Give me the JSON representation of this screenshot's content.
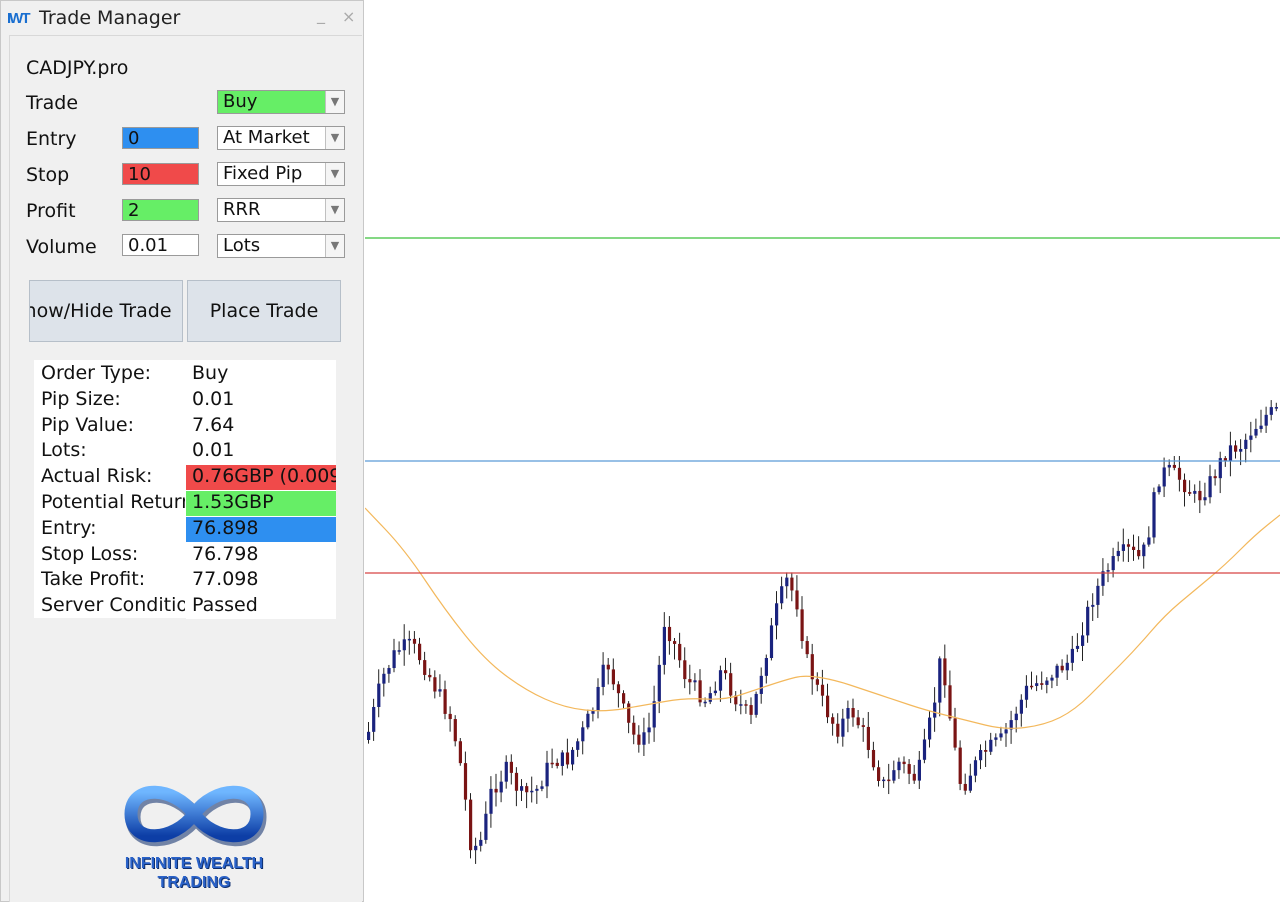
{
  "window": {
    "title": "Trade Manager",
    "logo_mark": "IWT",
    "minimize_glyph": "_",
    "close_glyph": "×"
  },
  "symbol": "CADJPY.pro",
  "form": {
    "trade": {
      "label": "Trade",
      "option": "Buy",
      "option_color": "#66ee66"
    },
    "entry": {
      "label": "Entry",
      "value": "0",
      "value_color": "#2e8ff0",
      "option": "At Market"
    },
    "stop": {
      "label": "Stop",
      "value": "10",
      "value_color": "#f04a4a",
      "option": "Fixed Pip"
    },
    "profit": {
      "label": "Profit",
      "value": "2",
      "value_color": "#66ee66",
      "option": "RRR"
    },
    "volume": {
      "label": "Volume",
      "value": "0.01",
      "value_color": "#ffffff",
      "option": "Lots"
    }
  },
  "buttons": {
    "show_hide": "Show/Hide Trade",
    "place_trade": "Place Trade"
  },
  "info": [
    {
      "key": "Order Type:",
      "value": "Buy",
      "color": "#ffffff"
    },
    {
      "key": "Pip Size:",
      "value": "0.01",
      "color": "#ffffff"
    },
    {
      "key": "Pip Value:",
      "value": "7.64",
      "color": "#ffffff"
    },
    {
      "key": "Lots:",
      "value": "0.01",
      "color": "#ffffff"
    },
    {
      "key": "Actual Risk:",
      "value": "0.76GBP (0.009",
      "color": "#f04a4a"
    },
    {
      "key": "Potential Return:",
      "value": "1.53GBP",
      "color": "#66ee66"
    },
    {
      "key": "Entry:",
      "value": "76.898",
      "color": "#2e8ff0"
    },
    {
      "key": "Stop Loss:",
      "value": "76.798",
      "color": "#ffffff"
    },
    {
      "key": "Take Profit:",
      "value": "77.098",
      "color": "#ffffff"
    },
    {
      "key": "Server Conditions:",
      "value": "Passed",
      "color": "#ffffff"
    }
  ],
  "brand": {
    "line1": "INFINITE WEALTH",
    "line2": "TRADING",
    "color": "#2a62c8"
  },
  "chart": {
    "colors": {
      "take_profit_line": "#5ccc5c",
      "entry_line": "#5a9ad8",
      "stop_line": "#d84444",
      "moving_average": "#f3b85c",
      "bull_candle": "#1a237e",
      "bear_candle": "#7a1414"
    }
  }
}
